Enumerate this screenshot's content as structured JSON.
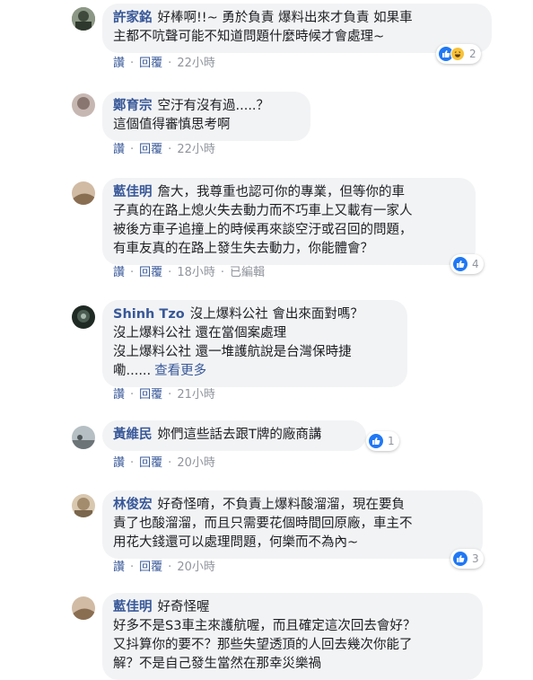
{
  "labels": {
    "like": "讚",
    "reply": "回覆",
    "dot": "·"
  },
  "colors": {
    "author": "#385898",
    "bubble": "#f2f3f5",
    "like": "#2078f4"
  },
  "comments": [
    {
      "author": "許家銘",
      "lines": [
        "好棒啊!!~ 勇於負責 爆料出來才負責 如果車",
        "主都不吭聲可能不知道問題什麼時候才會處理~"
      ],
      "time": "22小時",
      "edited": "",
      "reactions": "2",
      "more": "",
      "avatar_color": "#5a6a55"
    },
    {
      "author": "鄭育宗",
      "lines": [
        "空汙有沒有過.....？",
        "這個值得審慎思考啊"
      ],
      "time": "22小時",
      "edited": "",
      "reactions": "",
      "more": "",
      "avatar_color": "#a89590"
    },
    {
      "author": "藍佳明",
      "lines": [
        "詹大，我尊重也認可你的專業，但等你的車",
        "子真的在路上熄火失去動力而不巧車上又載有一家人",
        "被後方車子追撞上的時候再來談空汙或召回的問題，",
        "有車友真的在路上發生失去動力，你能體會？"
      ],
      "time": "18小時",
      "edited": "已編輯",
      "reactions": "4",
      "more": "",
      "avatar_color": "#b49a82"
    },
    {
      "author": "Shinh Tzo",
      "lines": [
        "沒上爆料公社 會出來面對嗎？",
        "沒上爆料公社 還在當個案處理",
        "沒上爆料公社 還一堆護航說是台灣保時捷",
        "嘞......"
      ],
      "time": "21小時",
      "edited": "",
      "reactions": "",
      "more": "查看更多",
      "avatar_color": "#2e3a33"
    },
    {
      "author": "黃維民",
      "lines": [
        "妳們這些話去跟T牌的廠商講"
      ],
      "time": "20小時",
      "edited": "",
      "reactions": "1",
      "more": "",
      "avatar_color": "#7f8a90"
    },
    {
      "author": "林俊宏",
      "lines": [
        "好奇怪唷，不負責上爆料酸溜溜，現在要負",
        "責了也酸溜溜，而且只需要花個時間回原廠，車主不",
        "用花大錢還可以處理問題，何樂而不為內~"
      ],
      "time": "20小時",
      "edited": "",
      "reactions": "3",
      "more": "",
      "avatar_color": "#b8a48c"
    },
    {
      "author": "藍佳明",
      "lines": [
        "好奇怪喔",
        "好多不是S3車主來護航喔，而且確定這次回去會好？",
        "又抖算你的要不？那些失望透頂的人回去幾次你能了",
        "解？不是自己發生當然在那幸災樂禍"
      ],
      "time": "",
      "edited": "",
      "reactions": "",
      "more": "",
      "avatar_color": "#b49a82"
    }
  ]
}
